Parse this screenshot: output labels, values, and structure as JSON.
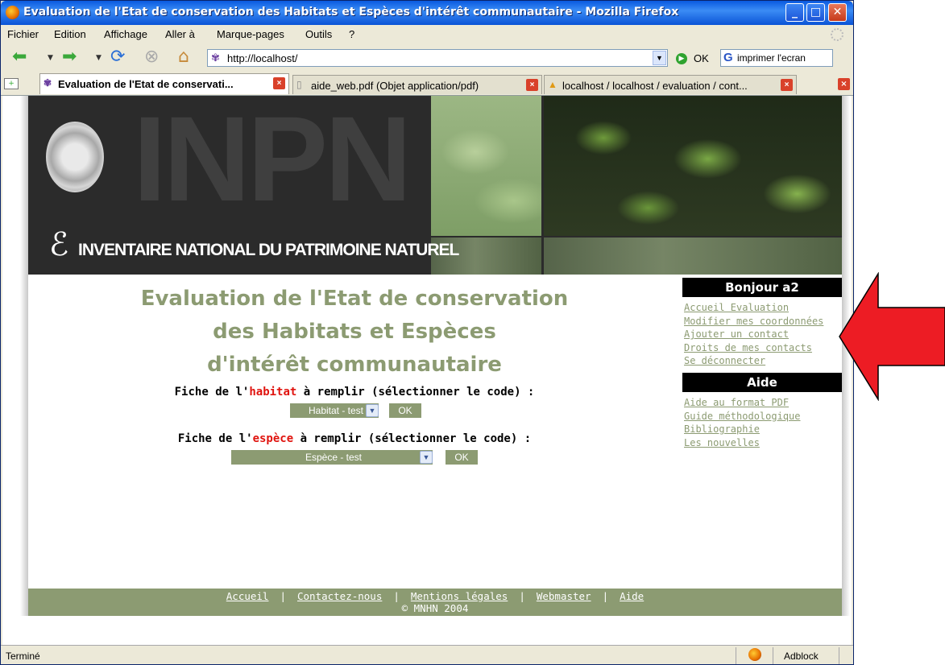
{
  "window": {
    "title": "Evaluation de l'Etat de conservation des Habitats et Espèces d'intérêt communautaire - Mozilla Firefox",
    "min_label": "_",
    "max_label": "□",
    "close_label": "✕"
  },
  "menu": {
    "items": [
      "Fichier",
      "Edition",
      "Affichage",
      "Aller à",
      "Marque-pages",
      "Outils",
      "?"
    ]
  },
  "nav": {
    "back_icon": "back-arrow-icon",
    "forward_icon": "forward-arrow-icon",
    "url": "http://localhost/",
    "go_label": "OK",
    "search_placeholder": "imprimer l'ecran",
    "search_engine_glyph": "G"
  },
  "tabs": [
    {
      "label": "Evaluation de l'Etat de conservati...",
      "active": true
    },
    {
      "label": "aide_web.pdf (Objet application/pdf)",
      "active": false
    },
    {
      "label": "localhost / localhost / evaluation  / cont...",
      "active": false
    }
  ],
  "banner": {
    "big_text": "INPN",
    "subtitle": "INVENTAIRE NATIONAL DU PATRIMOINE NATUREL"
  },
  "main": {
    "title_lines": [
      "Evaluation de l'Etat de conservation",
      "des Habitats et Espèces",
      "d'intérêt communautaire"
    ],
    "habitat_label_pre": "Fiche de l'",
    "habitat_label_hl": "habitat",
    "habitat_label_post": " à remplir (sélectionner le code) :",
    "habitat_select": "Habitat - test",
    "espece_label_pre": "Fiche de l'",
    "espece_label_hl": "espèce",
    "espece_label_post": " à remplir (sélectionner le code) :",
    "espece_select": "Espèce - test",
    "ok_label": "OK"
  },
  "sidebar": {
    "user_heading": "Bonjour a2",
    "user_links": [
      "Accueil Evaluation",
      "Modifier mes coordonnées",
      "Ajouter un contact",
      "Droits de mes contacts",
      "Se déconnecter"
    ],
    "help_heading": "Aide",
    "help_links": [
      "Aide au format PDF",
      "Guide méthodologique",
      "Bibliographie",
      "Les nouvelles"
    ]
  },
  "footer": {
    "links": [
      "Accueil",
      "Contactez-nous",
      "Mentions légales",
      "Webmaster",
      "Aide"
    ],
    "separator": "|",
    "copyright": "© MNHN 2004"
  },
  "status": {
    "text": "Terminé",
    "adblock": "Adblock"
  },
  "colors": {
    "accent_green": "#8c9b72",
    "highlight_red": "#e0140f",
    "arrow_red": "#ed1c24",
    "titlebar_blue": "#0a5ae0"
  }
}
